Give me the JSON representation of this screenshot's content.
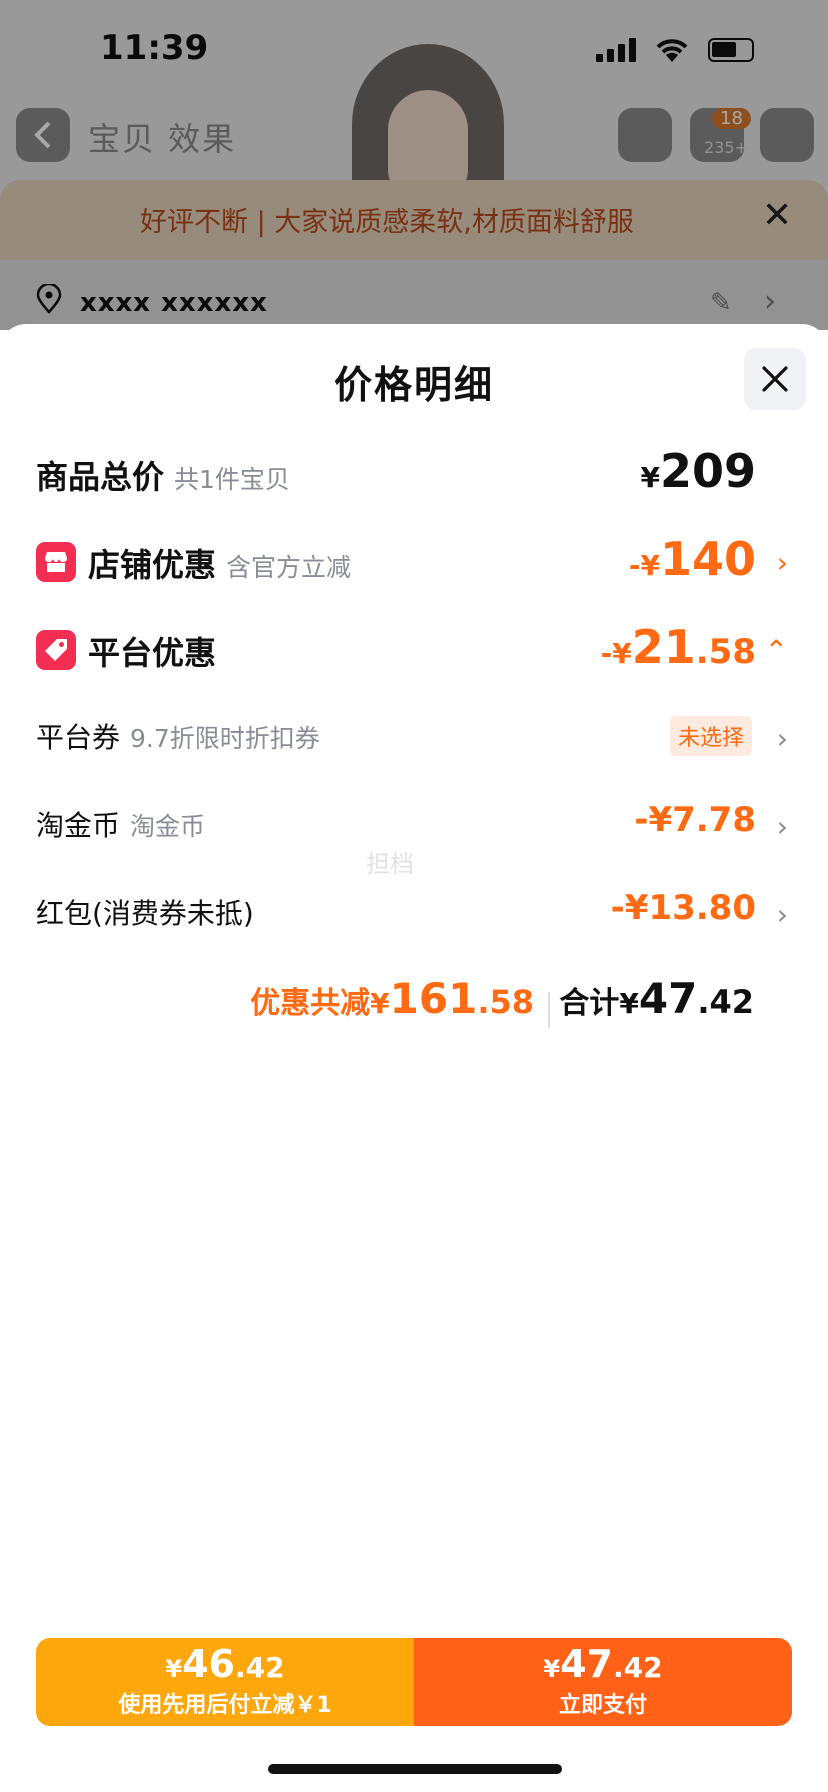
{
  "status": {
    "time": "11:39"
  },
  "background": {
    "nav_title": "宝贝  效果",
    "cart_badge": "18",
    "cart_count": "235+",
    "review_banner": "好评不断 | 大家说质感柔软,材质面料舒服",
    "address": "xxxx xxxxxx"
  },
  "sheet": {
    "title": "价格明细",
    "goods_total": {
      "label": "商品总价",
      "sub": "共1件宝贝",
      "currency": "¥",
      "amount": "209"
    },
    "shop_discount": {
      "label": "店铺优惠",
      "sub": "含官方立减",
      "prefix": "-¥",
      "amount": "140"
    },
    "platform_discount": {
      "label": "平台优惠",
      "prefix": "-¥",
      "int": "21",
      "dec": ".58"
    },
    "platform_coupon": {
      "label": "平台券",
      "sub": "9.7折限时折扣券",
      "status": "未选择"
    },
    "taojin": {
      "label": "淘金币",
      "sub": "淘金币",
      "value": "-¥7.78"
    },
    "redpack": {
      "label": "红包(消费券未抵)",
      "value": "-¥13.80"
    },
    "watermark": "担档",
    "summary": {
      "disc_label": "优惠共减",
      "disc_cur": "¥",
      "disc_int": "161",
      "disc_dec": ".58",
      "total_label": "合计",
      "total_cur": "¥",
      "total_int": "47",
      "total_dec": ".42"
    }
  },
  "pay": {
    "later": {
      "cur": "¥",
      "int": "46",
      "dec": ".42",
      "label": "使用先用后付立减￥1"
    },
    "now": {
      "cur": "¥",
      "int": "47",
      "dec": ".42",
      "label": "立即支付"
    }
  },
  "colors": {
    "accent": "#ff6a13",
    "pay_later": "#fea70c",
    "pay_now": "#ff6216",
    "icon_red": "#f42e52"
  }
}
